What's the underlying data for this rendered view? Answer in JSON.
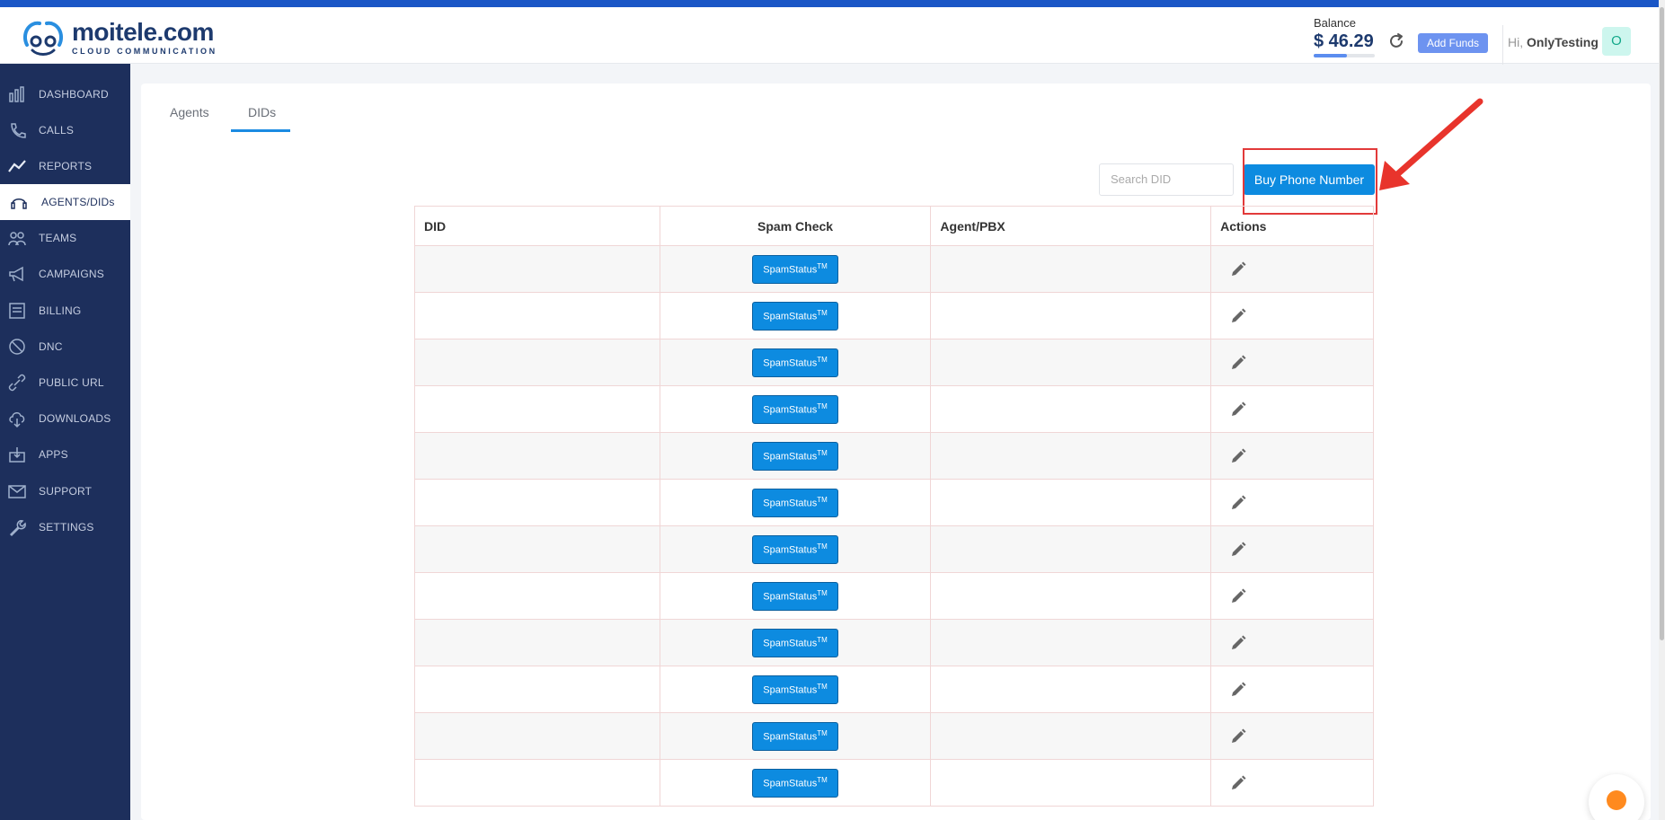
{
  "brand": {
    "name": "moitele.com",
    "tagline": "CLOUD COMMUNICATION"
  },
  "header": {
    "balance_label": "Balance",
    "balance_value": "$ 46.29",
    "balance_fill": 0.55,
    "add_funds_label": "Add Funds",
    "greeting_prefix": "Hi,",
    "user_name": "OnlyTesting",
    "avatar_initial": "O"
  },
  "sidebar": {
    "items": [
      {
        "label": "DASHBOARD",
        "icon": "dashboard-icon"
      },
      {
        "label": "CALLS",
        "icon": "phone-icon"
      },
      {
        "label": "REPORTS",
        "icon": "chart-line-icon"
      },
      {
        "label": "AGENTS/DIDs",
        "icon": "headset-icon",
        "active": true
      },
      {
        "label": "TEAMS",
        "icon": "team-icon"
      },
      {
        "label": "CAMPAIGNS",
        "icon": "megaphone-icon"
      },
      {
        "label": "BILLING",
        "icon": "billing-icon"
      },
      {
        "label": "DNC",
        "icon": "ban-icon"
      },
      {
        "label": "PUBLIC URL",
        "icon": "link-icon"
      },
      {
        "label": "DOWNLOADS",
        "icon": "cloud-download-icon"
      },
      {
        "label": "APPS",
        "icon": "apps-icon"
      },
      {
        "label": "SUPPORT",
        "icon": "mail-icon"
      },
      {
        "label": "SETTINGS",
        "icon": "wrench-icon"
      }
    ]
  },
  "tabs": [
    {
      "label": "Agents"
    },
    {
      "label": "DIDs",
      "active": true
    }
  ],
  "search": {
    "placeholder": "Search DID"
  },
  "buy_button_label": "Buy Phone Number",
  "table": {
    "headers": [
      "DID",
      "Spam Check",
      "Agent/PBX",
      "Actions"
    ],
    "spam_label": "SpamStatus",
    "spam_sup": "TM",
    "row_count": 12
  },
  "colors": {
    "accent": "#0d8be0",
    "sidebar": "#1d2f5c",
    "highlight": "#e23a3a"
  }
}
